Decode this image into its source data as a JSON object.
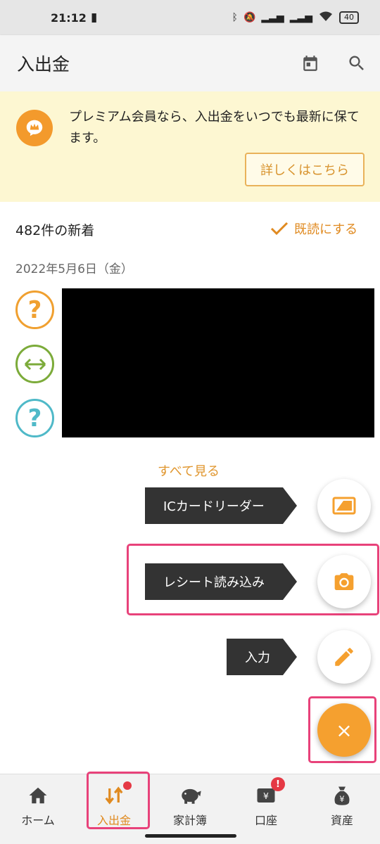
{
  "status_bar": {
    "time": "21:12",
    "battery": "40"
  },
  "app_bar": {
    "title": "入出金"
  },
  "promo": {
    "text": "プレミアム会員なら、入出金をいつでも最新に保てます。",
    "button": "詳しくはこちら"
  },
  "feed": {
    "new_count": "482件の新着",
    "mark_read": "既読にする",
    "date": "2022年5月6日（金）",
    "see_all": "すべて見る"
  },
  "fab_menu": {
    "ic_card": "ICカードリーダー",
    "receipt": "レシート読み込み",
    "input": "入力",
    "close": "×"
  },
  "nav": [
    {
      "label": "ホーム",
      "icon": "home-icon"
    },
    {
      "label": "入出金",
      "icon": "transfer-icon"
    },
    {
      "label": "家計簿",
      "icon": "piggy-bank-icon"
    },
    {
      "label": "口座",
      "icon": "account-icon"
    },
    {
      "label": "資産",
      "icon": "money-bag-icon"
    }
  ],
  "colors": {
    "accent": "#f5a02f",
    "highlight": "#e8427a",
    "promo_bg": "#fdf7d2",
    "badge": "#e53945"
  }
}
